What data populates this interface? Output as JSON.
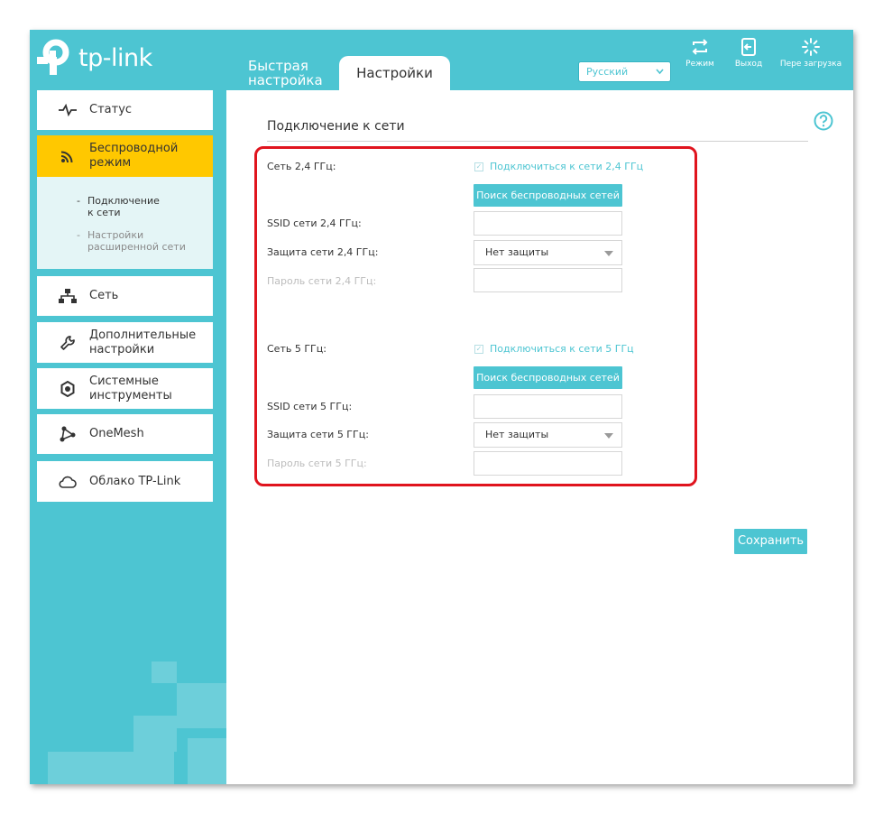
{
  "header": {
    "logo_text": "tp-link",
    "tabs": [
      {
        "label": "Быстрая настройка"
      },
      {
        "label": "Настройки"
      }
    ],
    "language": "Русский",
    "buttons": [
      {
        "label": "Режим",
        "icon": "mode-icon"
      },
      {
        "label": "Выход",
        "icon": "logout-icon"
      },
      {
        "label": "Пере загрузка",
        "icon": "reboot-icon"
      }
    ]
  },
  "sidebar": {
    "items": [
      {
        "label": "Статус",
        "icon": "pulse-icon"
      },
      {
        "label": "Беспроводной режим",
        "icon": "wifi-icon"
      },
      {
        "label": "Сеть",
        "icon": "network-icon"
      },
      {
        "label": "Дополнительные настройки",
        "icon": "wrench-icon"
      },
      {
        "label": "Системные инструменты",
        "icon": "gear-icon"
      },
      {
        "label": "OneMesh",
        "icon": "mesh-icon"
      },
      {
        "label": "Облако TP-Link",
        "icon": "cloud-icon"
      }
    ],
    "submenu": [
      {
        "label": "Подключение к сети"
      },
      {
        "label": "Настройки расширенной сети"
      }
    ]
  },
  "main": {
    "title": "Подключение к сети",
    "band24": {
      "network_label": "Сеть 2,4 ГГц:",
      "connect_label": "Подключиться к сети 2,4 ГГц",
      "scan_button": "Поиск беспроводных сетей",
      "ssid_label": "SSID сети 2,4 ГГц:",
      "ssid_value": "",
      "security_label": "Защита сети 2,4 ГГц:",
      "security_value": "Нет защиты",
      "password_label": "Пароль сети 2,4 ГГц:",
      "password_value": ""
    },
    "band5": {
      "network_label": "Сеть 5 ГГц:",
      "connect_label": "Подключиться к сети 5 ГГц",
      "scan_button": "Поиск беспроводных сетей",
      "ssid_label": "SSID сети 5 ГГц:",
      "ssid_value": "",
      "security_label": "Защита сети 5 ГГц:",
      "security_value": "Нет защиты",
      "password_label": "Пароль сети 5 ГГц:",
      "password_value": ""
    },
    "save_button": "Сохранить"
  },
  "colors": {
    "accent": "#4dc5d2",
    "active_menu": "#ffc800",
    "highlight_box": "#e0141e"
  }
}
